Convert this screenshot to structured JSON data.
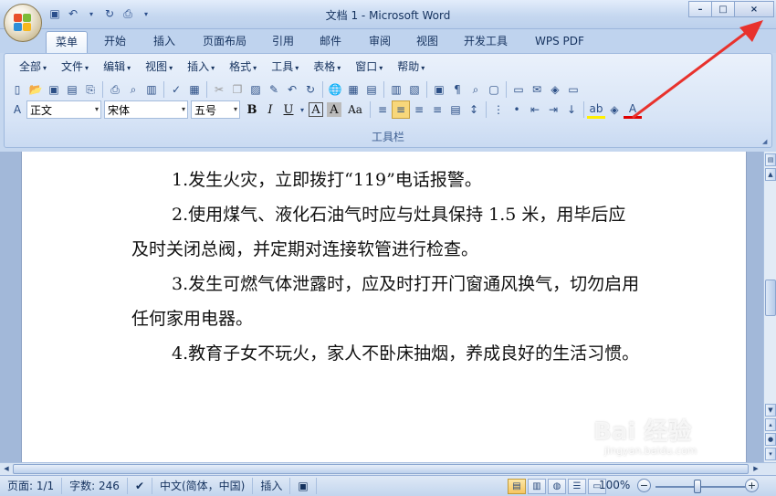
{
  "window": {
    "title": "文档 1 - Microsoft Word",
    "minimize": "–",
    "maximize": "□",
    "close": "×"
  },
  "tabs": [
    "菜单",
    "开始",
    "插入",
    "页面布局",
    "引用",
    "邮件",
    "审阅",
    "视图",
    "开发工具",
    "WPS PDF"
  ],
  "active_tab": "菜单",
  "menus": [
    "全部",
    "文件",
    "编辑",
    "视图",
    "插入",
    "格式",
    "工具",
    "表格",
    "窗口",
    "帮助"
  ],
  "formatting": {
    "style": "正文",
    "font": "宋体",
    "size": "五号",
    "bold": "B",
    "italic": "I",
    "underline": "U",
    "char_border": "A",
    "char_shading": "A",
    "change_case": "Aa"
  },
  "ribbon_group_label": "工具栏",
  "document": {
    "paragraphs": [
      "1.发生火灾，立即拨打“119”电话报警。",
      "2.使用煤气、液化石油气时应与灶具保持 1.5 米，用毕后应及时关闭总阀，并定期对连接软管进行检查。",
      "3.发生可燃气体泄露时，应及时打开门窗通风换气，切勿启用任何家用电器。",
      "4.教育子女不玩火，家人不卧床抽烟，养成良好的生活习惯。"
    ]
  },
  "status": {
    "page": "页面: 1/1",
    "words": "字数: 246",
    "language": "中文(简体，中国)",
    "mode": "插入",
    "zoom": "100%"
  },
  "watermark": {
    "text": "Bai 经验",
    "sub": "jingyan.baidu.com"
  },
  "colors": {
    "annotation_arrow": "#e8322d",
    "accent": "#15428b"
  }
}
